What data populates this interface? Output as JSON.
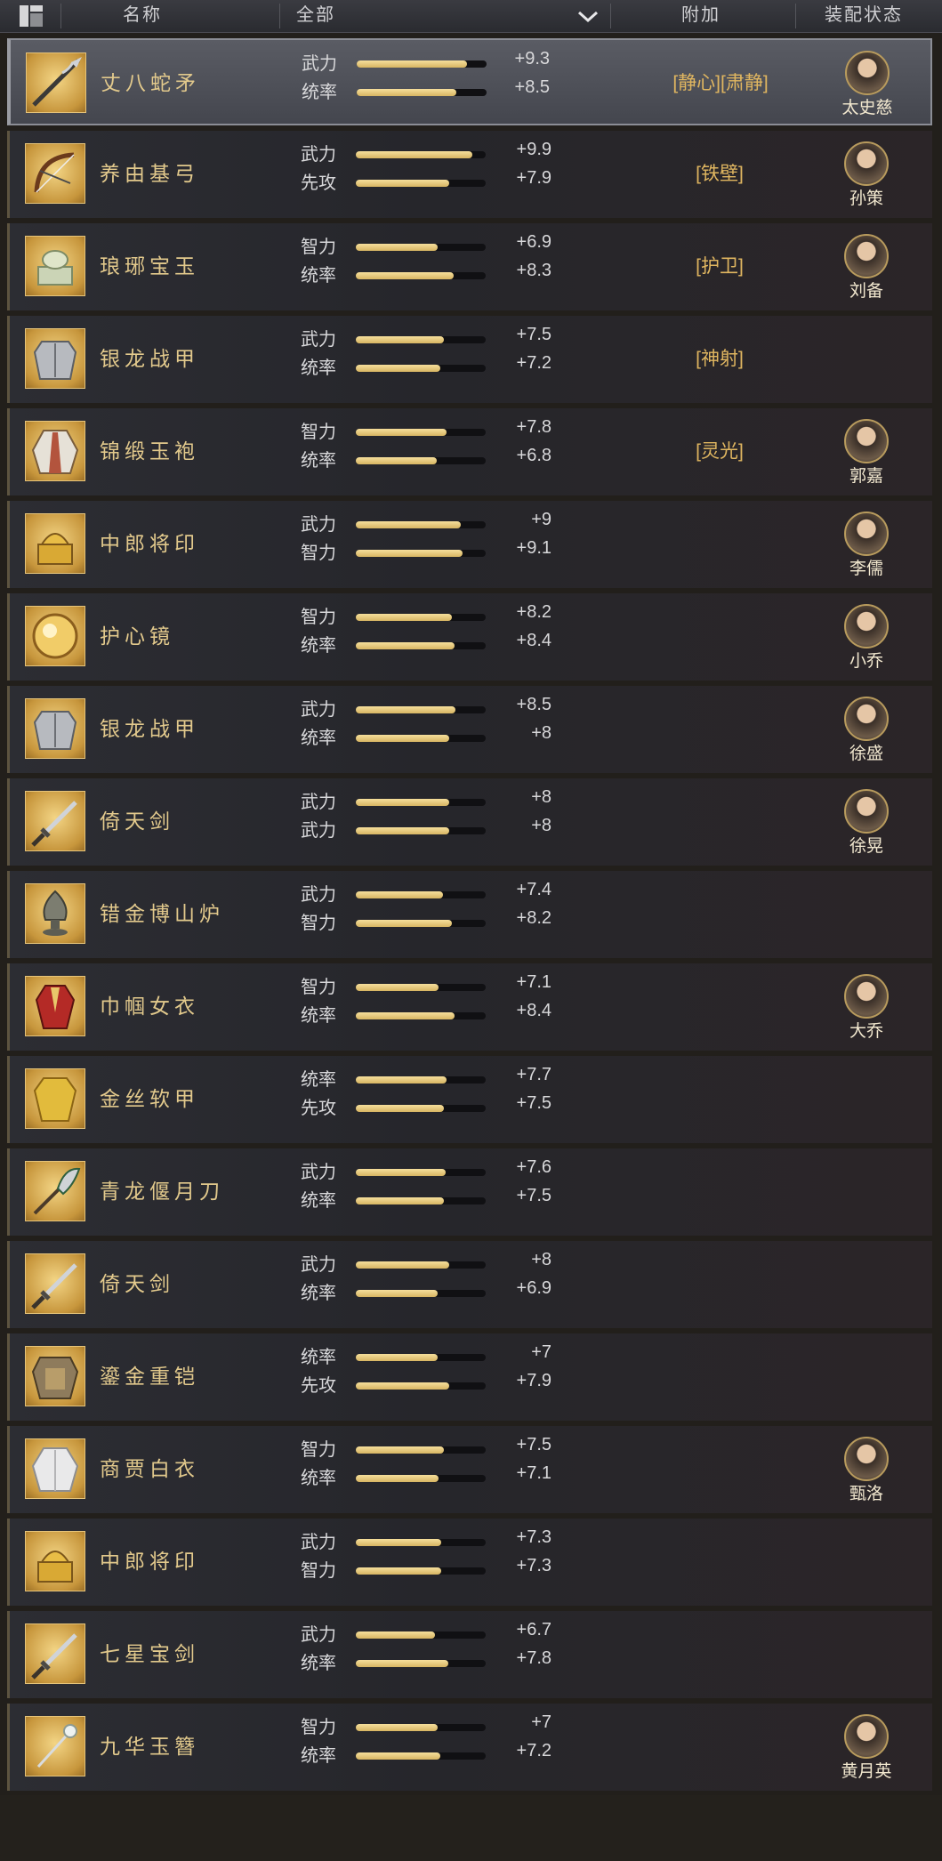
{
  "header": {
    "col_name": "名称",
    "col_filter": "全部",
    "col_extra": "附加",
    "col_status": "装配状态"
  },
  "items": [
    {
      "name": "丈八蛇矛",
      "stat1": "武力",
      "val1": "+9.3",
      "fill1": 0.85,
      "stat2": "统率",
      "val2": "+8.5",
      "fill2": 0.77,
      "extra": "[静心][肃静]",
      "hero": "太史慈",
      "icon": "spear-icon",
      "selected": true
    },
    {
      "name": "养由基弓",
      "stat1": "武力",
      "val1": "+9.9",
      "fill1": 0.9,
      "stat2": "先攻",
      "val2": "+7.9",
      "fill2": 0.72,
      "extra": "[铁壁]",
      "hero": "孙策",
      "icon": "bow-icon"
    },
    {
      "name": "琅琊宝玉",
      "stat1": "智力",
      "val1": "+6.9",
      "fill1": 0.63,
      "stat2": "统率",
      "val2": "+8.3",
      "fill2": 0.75,
      "extra": "[护卫]",
      "hero": "刘备",
      "icon": "jade-seal-icon"
    },
    {
      "name": "银龙战甲",
      "stat1": "武力",
      "val1": "+7.5",
      "fill1": 0.68,
      "stat2": "统率",
      "val2": "+7.2",
      "fill2": 0.65,
      "extra": "[神射]",
      "hero": "",
      "icon": "armor-icon"
    },
    {
      "name": "锦缎玉袍",
      "stat1": "智力",
      "val1": "+7.8",
      "fill1": 0.7,
      "stat2": "统率",
      "val2": "+6.8",
      "fill2": 0.62,
      "extra": "[灵光]",
      "hero": "郭嘉",
      "icon": "robe-icon"
    },
    {
      "name": "中郎将印",
      "stat1": "武力",
      "val1": "+9",
      "fill1": 0.81,
      "stat2": "智力",
      "val2": "+9.1",
      "fill2": 0.82,
      "extra": "",
      "hero": "李儒",
      "icon": "seal-icon"
    },
    {
      "name": "护心镜",
      "stat1": "智力",
      "val1": "+8.2",
      "fill1": 0.74,
      "stat2": "统率",
      "val2": "+8.4",
      "fill2": 0.76,
      "extra": "",
      "hero": "小乔",
      "icon": "mirror-icon"
    },
    {
      "name": "银龙战甲",
      "stat1": "武力",
      "val1": "+8.5",
      "fill1": 0.77,
      "stat2": "统率",
      "val2": "+8",
      "fill2": 0.72,
      "extra": "",
      "hero": "徐盛",
      "icon": "armor-icon"
    },
    {
      "name": "倚天剑",
      "stat1": "武力",
      "val1": "+8",
      "fill1": 0.72,
      "stat2": "武力",
      "val2": "+8",
      "fill2": 0.72,
      "extra": "",
      "hero": "徐晃",
      "icon": "sword-icon"
    },
    {
      "name": "错金博山炉",
      "stat1": "武力",
      "val1": "+7.4",
      "fill1": 0.67,
      "stat2": "智力",
      "val2": "+8.2",
      "fill2": 0.74,
      "extra": "",
      "hero": "",
      "icon": "censer-icon"
    },
    {
      "name": "巾帼女衣",
      "stat1": "智力",
      "val1": "+7.1",
      "fill1": 0.64,
      "stat2": "统率",
      "val2": "+8.4",
      "fill2": 0.76,
      "extra": "",
      "hero": "大乔",
      "icon": "dress-icon"
    },
    {
      "name": "金丝软甲",
      "stat1": "统率",
      "val1": "+7.7",
      "fill1": 0.7,
      "stat2": "先攻",
      "val2": "+7.5",
      "fill2": 0.68,
      "extra": "",
      "hero": "",
      "icon": "golden-vest-icon"
    },
    {
      "name": "青龙偃月刀",
      "stat1": "武力",
      "val1": "+7.6",
      "fill1": 0.69,
      "stat2": "统率",
      "val2": "+7.5",
      "fill2": 0.68,
      "extra": "",
      "hero": "",
      "icon": "glaive-icon"
    },
    {
      "name": "倚天剑",
      "stat1": "武力",
      "val1": "+8",
      "fill1": 0.72,
      "stat2": "统率",
      "val2": "+6.9",
      "fill2": 0.63,
      "extra": "",
      "hero": "",
      "icon": "sword-icon"
    },
    {
      "name": "鎏金重铠",
      "stat1": "统率",
      "val1": "+7",
      "fill1": 0.63,
      "stat2": "先攻",
      "val2": "+7.9",
      "fill2": 0.72,
      "extra": "",
      "hero": "",
      "icon": "heavy-armor-icon"
    },
    {
      "name": "商贾白衣",
      "stat1": "智力",
      "val1": "+7.5",
      "fill1": 0.68,
      "stat2": "统率",
      "val2": "+7.1",
      "fill2": 0.64,
      "extra": "",
      "hero": "甄洛",
      "icon": "white-robe-icon"
    },
    {
      "name": "中郎将印",
      "stat1": "武力",
      "val1": "+7.3",
      "fill1": 0.66,
      "stat2": "智力",
      "val2": "+7.3",
      "fill2": 0.66,
      "extra": "",
      "hero": "",
      "icon": "seal-icon"
    },
    {
      "name": "七星宝剑",
      "stat1": "武力",
      "val1": "+6.7",
      "fill1": 0.61,
      "stat2": "统率",
      "val2": "+7.8",
      "fill2": 0.71,
      "extra": "",
      "hero": "",
      "icon": "sword-icon"
    },
    {
      "name": "九华玉簪",
      "stat1": "智力",
      "val1": "+7",
      "fill1": 0.63,
      "stat2": "统率",
      "val2": "+7.2",
      "fill2": 0.65,
      "extra": "",
      "hero": "黄月英",
      "icon": "hairpin-icon"
    }
  ]
}
